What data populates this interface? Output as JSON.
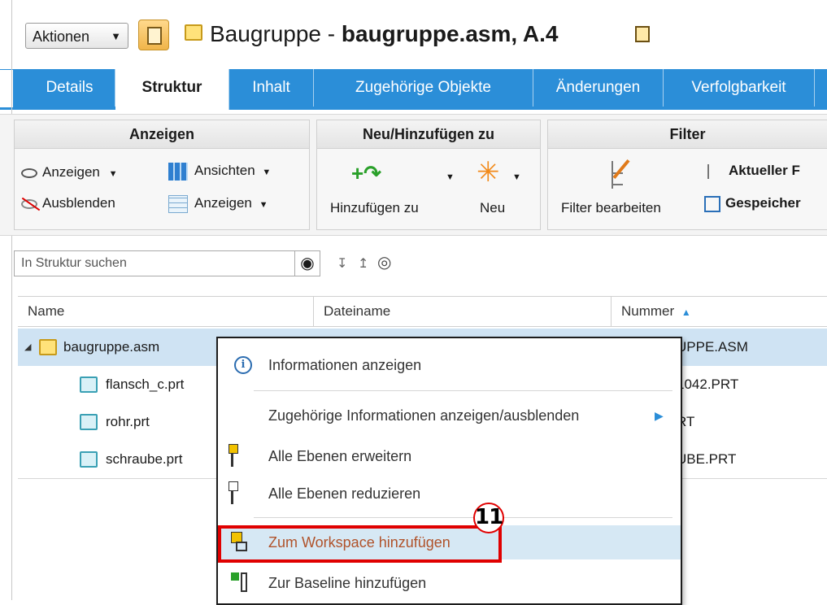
{
  "header": {
    "actions_label": "Aktionen",
    "title_prefix": "Baugruppe - ",
    "title_bold": "baugruppe.asm, A.4"
  },
  "tabs": [
    "Details",
    "Struktur",
    "Inhalt",
    "Zugehörige Objekte",
    "Änderungen",
    "Verfolgbarkeit"
  ],
  "ribbon": {
    "group_anzeigen": {
      "title": "Anzeigen",
      "show": "Anzeigen",
      "hide": "Ausblenden",
      "views": "Ansichten",
      "display": "Anzeigen"
    },
    "group_neu": {
      "title": "Neu/Hinzufügen zu",
      "add_to": "Hinzufügen zu",
      "new": "Neu"
    },
    "group_filter": {
      "title": "Filter",
      "edit": "Filter bearbeiten",
      "current": "Aktueller F",
      "saved": "Gespeicher"
    }
  },
  "search": {
    "placeholder": "In Struktur suchen"
  },
  "grid": {
    "columns": [
      "Name",
      "Dateiname",
      "Nummer"
    ],
    "rows": [
      {
        "name": "baugruppe.asm",
        "nummer": "UPPE.ASM"
      },
      {
        "name": "flansch_c.prt",
        "nummer": "1042.PRT"
      },
      {
        "name": "rohr.prt",
        "nummer": "RT"
      },
      {
        "name": "schraube.prt",
        "nummer": "UBE.PRT"
      }
    ]
  },
  "context_menu": {
    "items": [
      "Informationen anzeigen",
      "Zugehörige Informationen anzeigen/ausblenden",
      "Alle Ebenen erweitern",
      "Alle Ebenen reduzieren",
      "Zum Workspace hinzufügen",
      "Zur Baseline hinzufügen"
    ]
  },
  "annotation": {
    "step": "11"
  },
  "colors": {
    "tab_blue": "#2b8ed8",
    "selection": "#cfe3f3",
    "highlight_red": "#e00000"
  }
}
